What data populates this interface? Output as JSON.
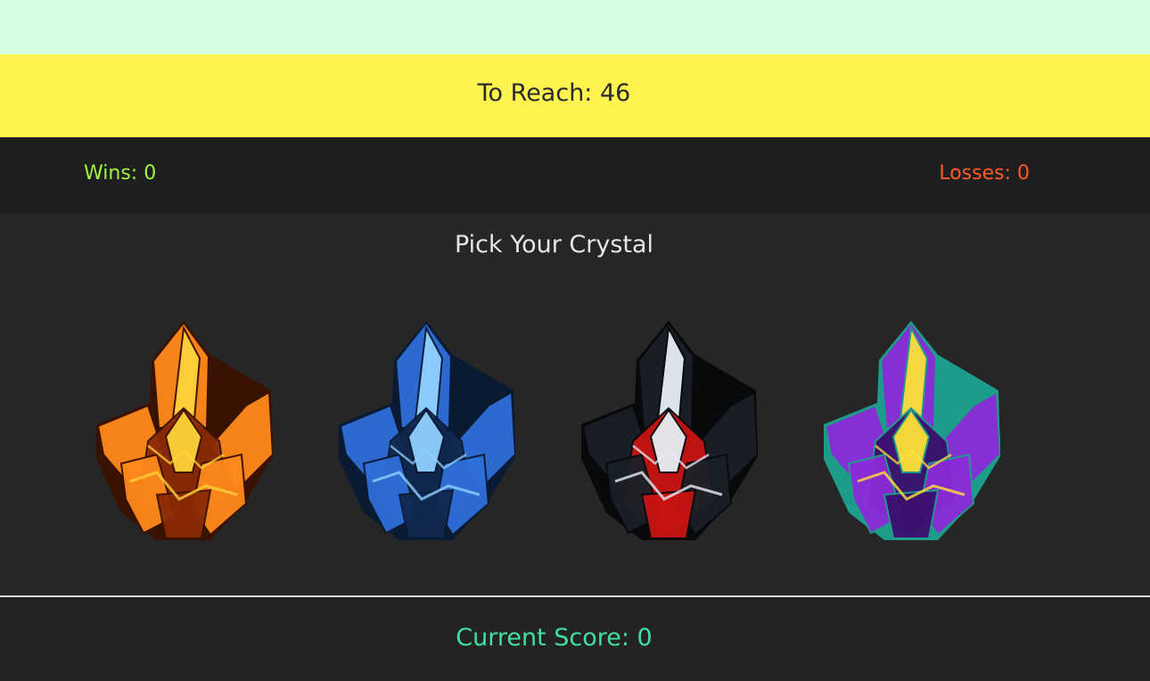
{
  "header": {
    "target_label": "To Reach: 46"
  },
  "stats": {
    "wins_label": "Wins: 0",
    "losses_label": "Losses: 0"
  },
  "play": {
    "title": "Pick Your Crystal",
    "crystals": [
      {
        "name": "orange-crystal-icon",
        "main": "#ff8a1c",
        "light": "#ffd23a",
        "dark": "#8a2a05",
        "edge": "#3a1202"
      },
      {
        "name": "blue-crystal-icon",
        "main": "#2f6fd8",
        "light": "#8fd0ff",
        "dark": "#10284f",
        "edge": "#0b1a33"
      },
      {
        "name": "black-red-crystal-icon",
        "main": "#1a2028",
        "light": "#e6eef5",
        "dark": "#c91414",
        "edge": "#07090b"
      },
      {
        "name": "purple-crystal-icon",
        "main": "#8a2bd8",
        "light": "#ffe23a",
        "dark": "#3b0f6e",
        "edge": "#1e9c8a"
      }
    ]
  },
  "footer": {
    "score_label": "Current Score: 0"
  }
}
